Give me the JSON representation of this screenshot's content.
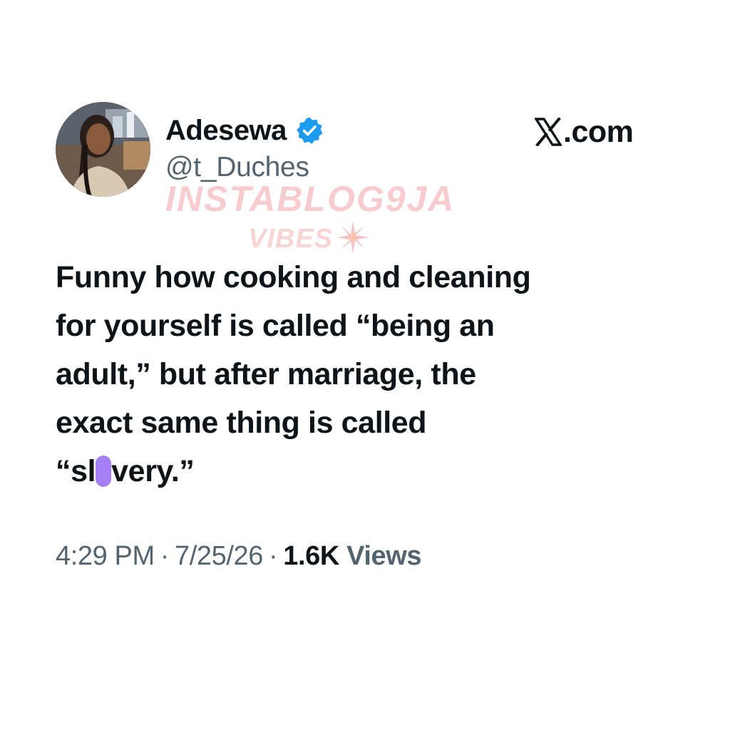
{
  "author": {
    "display_name": "Adesewa",
    "handle": "@t_Duches",
    "verified": true,
    "verified_color": "#1d9bf0"
  },
  "source": {
    "site_label": ".com",
    "logo": "x-logo-icon"
  },
  "watermark": {
    "line1": "INSTABLOG9JA",
    "line2": "VIBES",
    "color": "#ec787d"
  },
  "tweet": {
    "lines": [
      "Funny how cooking and cleaning",
      "for yourself is called “being an",
      "adult,” but after marriage, the",
      "exact same thing is called"
    ],
    "last_line_before": "“sl",
    "last_line_after": "very.”",
    "redaction_color": "#a77ff4"
  },
  "meta": {
    "time": "4:29 PM",
    "separator": "·",
    "date": "7/25/26",
    "views_count": "1.6K",
    "views_label": "Views"
  }
}
